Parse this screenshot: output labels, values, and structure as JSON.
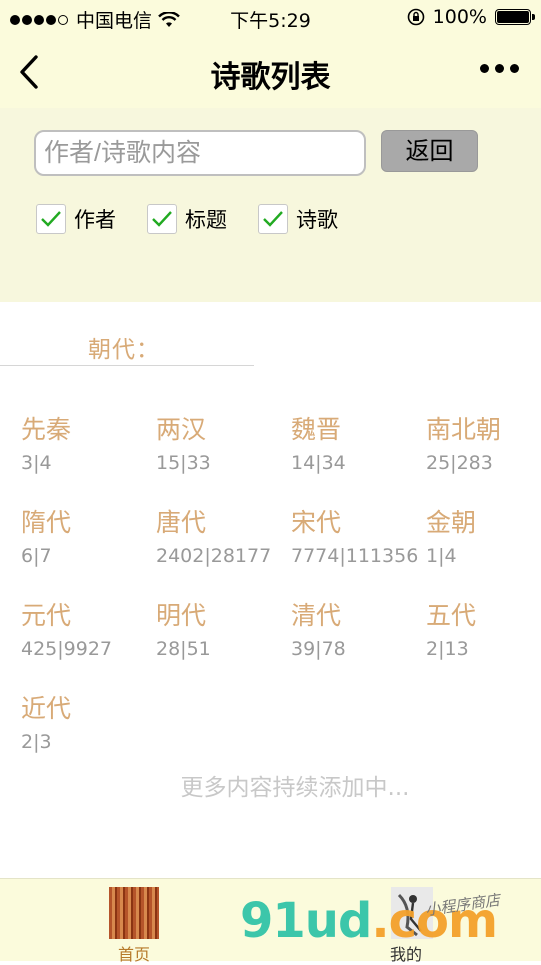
{
  "status_bar": {
    "carrier": "中国电信",
    "time": "下午5:29",
    "battery": "100%"
  },
  "nav": {
    "title": "诗歌列表"
  },
  "search": {
    "placeholder": "作者/诗歌内容",
    "back_label": "返回",
    "filters": [
      {
        "label": "作者",
        "checked": true
      },
      {
        "label": "标题",
        "checked": true
      },
      {
        "label": "诗歌",
        "checked": true
      }
    ]
  },
  "dynasty_section": {
    "label": "朝代：",
    "items": [
      {
        "name": "先秦",
        "count": "3|4"
      },
      {
        "name": "两汉",
        "count": "15|33"
      },
      {
        "name": "魏晋",
        "count": "14|34"
      },
      {
        "name": "南北朝",
        "count": "25|283"
      },
      {
        "name": "隋代",
        "count": "6|7"
      },
      {
        "name": "唐代",
        "count": "2402|28177"
      },
      {
        "name": "宋代",
        "count": "7774|111356"
      },
      {
        "name": "金朝",
        "count": "1|4"
      },
      {
        "name": "元代",
        "count": "425|9927"
      },
      {
        "name": "明代",
        "count": "28|51"
      },
      {
        "name": "清代",
        "count": "39|78"
      },
      {
        "name": "五代",
        "count": "2|13"
      },
      {
        "name": "近代",
        "count": "2|3"
      }
    ],
    "more_text": "更多内容持续添加中..."
  },
  "tabbar": {
    "home_label": "首页",
    "me_label": "我的"
  },
  "watermark": {
    "main": "91ud",
    "suffix": ".com",
    "sub": "小程序商店"
  },
  "colors": {
    "header_bg": "#fbfbdc",
    "accent": "#d8aa77",
    "check": "#22aa22"
  }
}
